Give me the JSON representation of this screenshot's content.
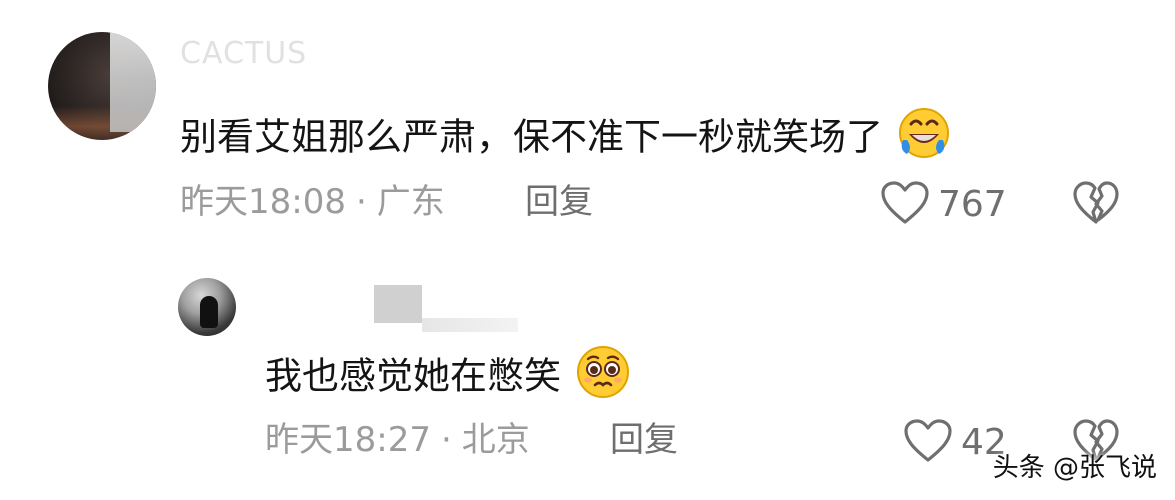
{
  "comment": {
    "username": "CACTUS",
    "text": "别看艾姐那么严肃，保不准下一秒就笑场了",
    "emoji": "rofl-emoji",
    "time": "昨天18:08",
    "location": "广东",
    "reply_label": "回复",
    "likes": "767"
  },
  "reply": {
    "text": "我也感觉她在憋笑",
    "emoji": "pleading-face-emoji",
    "time": "昨天18:27",
    "location": "北京",
    "reply_label": "回复",
    "likes": "42"
  },
  "meta_separator": "·",
  "watermark": "头条 @张飞说",
  "colors": {
    "meta_text": "#9b9b9b",
    "body_text": "#141414",
    "icon_stroke": "#6f6f6f",
    "emoji_yellow": "#ffcc33",
    "emoji_tear": "#2f8fe6"
  }
}
